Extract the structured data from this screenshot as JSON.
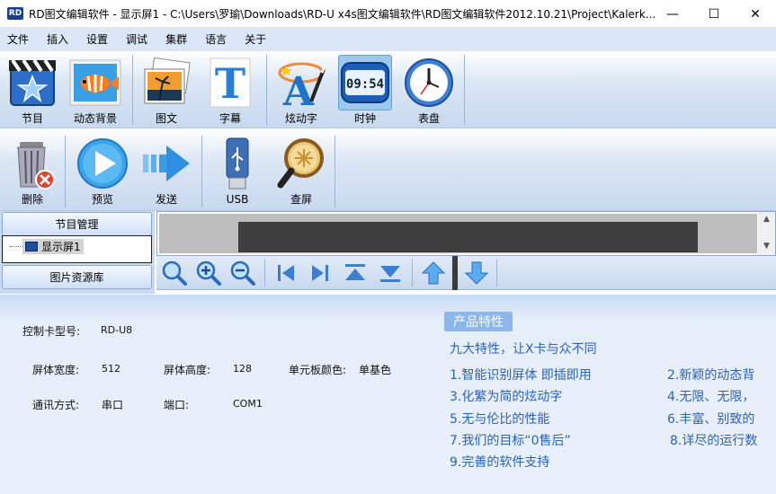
{
  "window": {
    "title": "RD图文编辑软件 - 显示屏1 - C:\\Users\\罗瑜\\Downloads\\RD-U x4s图文编辑软件\\RD图文编辑软件2012.10.21\\Project\\Kalerk...",
    "app_icon": "RD",
    "minimize": "—",
    "maximize": "☐",
    "close": "✕"
  },
  "menu": [
    "文件",
    "插入",
    "设置",
    "调试",
    "集群",
    "语言",
    "关于"
  ],
  "toolbar1": [
    {
      "label": "节目",
      "icon": "program-icon"
    },
    {
      "label": "动态背景",
      "icon": "dynamic-background-icon"
    },
    {
      "label": "图文",
      "icon": "picture-text-icon"
    },
    {
      "label": "字幕",
      "icon": "subtitle-icon"
    },
    {
      "label": "炫动字",
      "icon": "animated-text-icon"
    },
    {
      "label": "时钟",
      "icon": "digital-clock-icon"
    },
    {
      "label": "表盘",
      "icon": "analog-clock-icon"
    }
  ],
  "toolbar2": [
    {
      "label": "删除",
      "icon": "delete-icon"
    },
    {
      "label": "预览",
      "icon": "preview-icon"
    },
    {
      "label": "发送",
      "icon": "send-icon"
    },
    {
      "label": "USB",
      "icon": "usb-icon"
    },
    {
      "label": "查屏",
      "icon": "find-screen-icon"
    }
  ],
  "clock_display": "09:54",
  "left_panel": {
    "program_manager": "节目管理",
    "tree_item": "显示屏1",
    "image_library": "图片资源库"
  },
  "info": {
    "card_model_label": "控制卡型号:",
    "card_model": "RD-U8",
    "width_label": "屏体宽度:",
    "width": "512",
    "height_label": "屏体高度:",
    "height": "128",
    "color_label": "单元板颜色:",
    "color": "单基色",
    "comm_label": "通讯方式:",
    "comm": "串口",
    "port_label": "端口:",
    "port": "COM1"
  },
  "features": {
    "badge": "产品特性",
    "headline": "九大特性，让X卡与众不同",
    "f1": "1.智能识别屏体  即插即用",
    "f2": "2.新颖的动态背",
    "f3": "3.化繁为简的炫动字",
    "f4": "4.无限、无限，",
    "f5": "5.无与伦比的性能",
    "f6": "6.丰富、别致的",
    "f7": "7.我们的目标“0售后”",
    "f8": "8.详尽的运行数",
    "f9": "9.完善的软件支持"
  },
  "colors": {
    "menubar": "#dbe7f7",
    "feature_text": "#2b63b8",
    "feature_badge": "#8db7ea"
  }
}
